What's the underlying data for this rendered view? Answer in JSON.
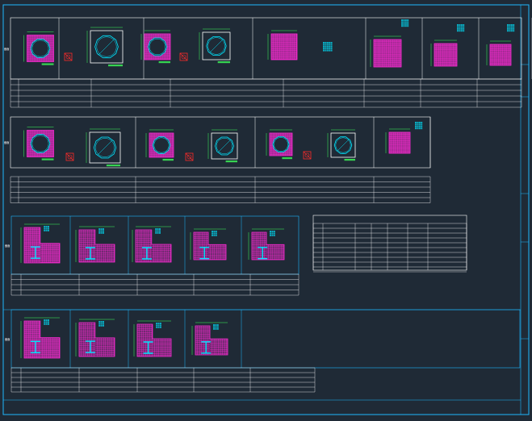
{
  "sheet": {
    "background": "#1f2a36",
    "frame_color": "#1fb8ff",
    "table_color": "#ffffff",
    "concrete_color": "#ff2bd6",
    "rebar_color": "#00e6ff",
    "dim_color": "#3dff5a",
    "accent_red": "#ff2a2a"
  },
  "groups": {
    "circular_row": {
      "title": "",
      "section_label": "截面"
    },
    "circular_row2": {
      "title": "",
      "section_label": "截面"
    },
    "special_row": {
      "title": "",
      "section_label": "截面"
    },
    "special_row2": {
      "title": "",
      "section_label": "截面"
    }
  },
  "schedule_table": {
    "title": "",
    "header": [
      "",
      "",
      "",
      "",
      "",
      ""
    ],
    "rows": [
      [
        "",
        "",
        "",
        "",
        "",
        ""
      ],
      [
        "",
        "",
        "",
        "",
        "",
        ""
      ],
      [
        "",
        "",
        "",
        "",
        "",
        ""
      ],
      [
        "",
        "",
        "",
        "",
        "",
        ""
      ],
      [
        "",
        "",
        "",
        "",
        "",
        ""
      ],
      [
        "",
        "",
        "",
        "",
        "",
        ""
      ],
      [
        "",
        "",
        "",
        "",
        "",
        ""
      ],
      [
        "",
        "",
        "",
        "",
        "",
        ""
      ],
      [
        "",
        "",
        "",
        "",
        "",
        ""
      ]
    ]
  }
}
